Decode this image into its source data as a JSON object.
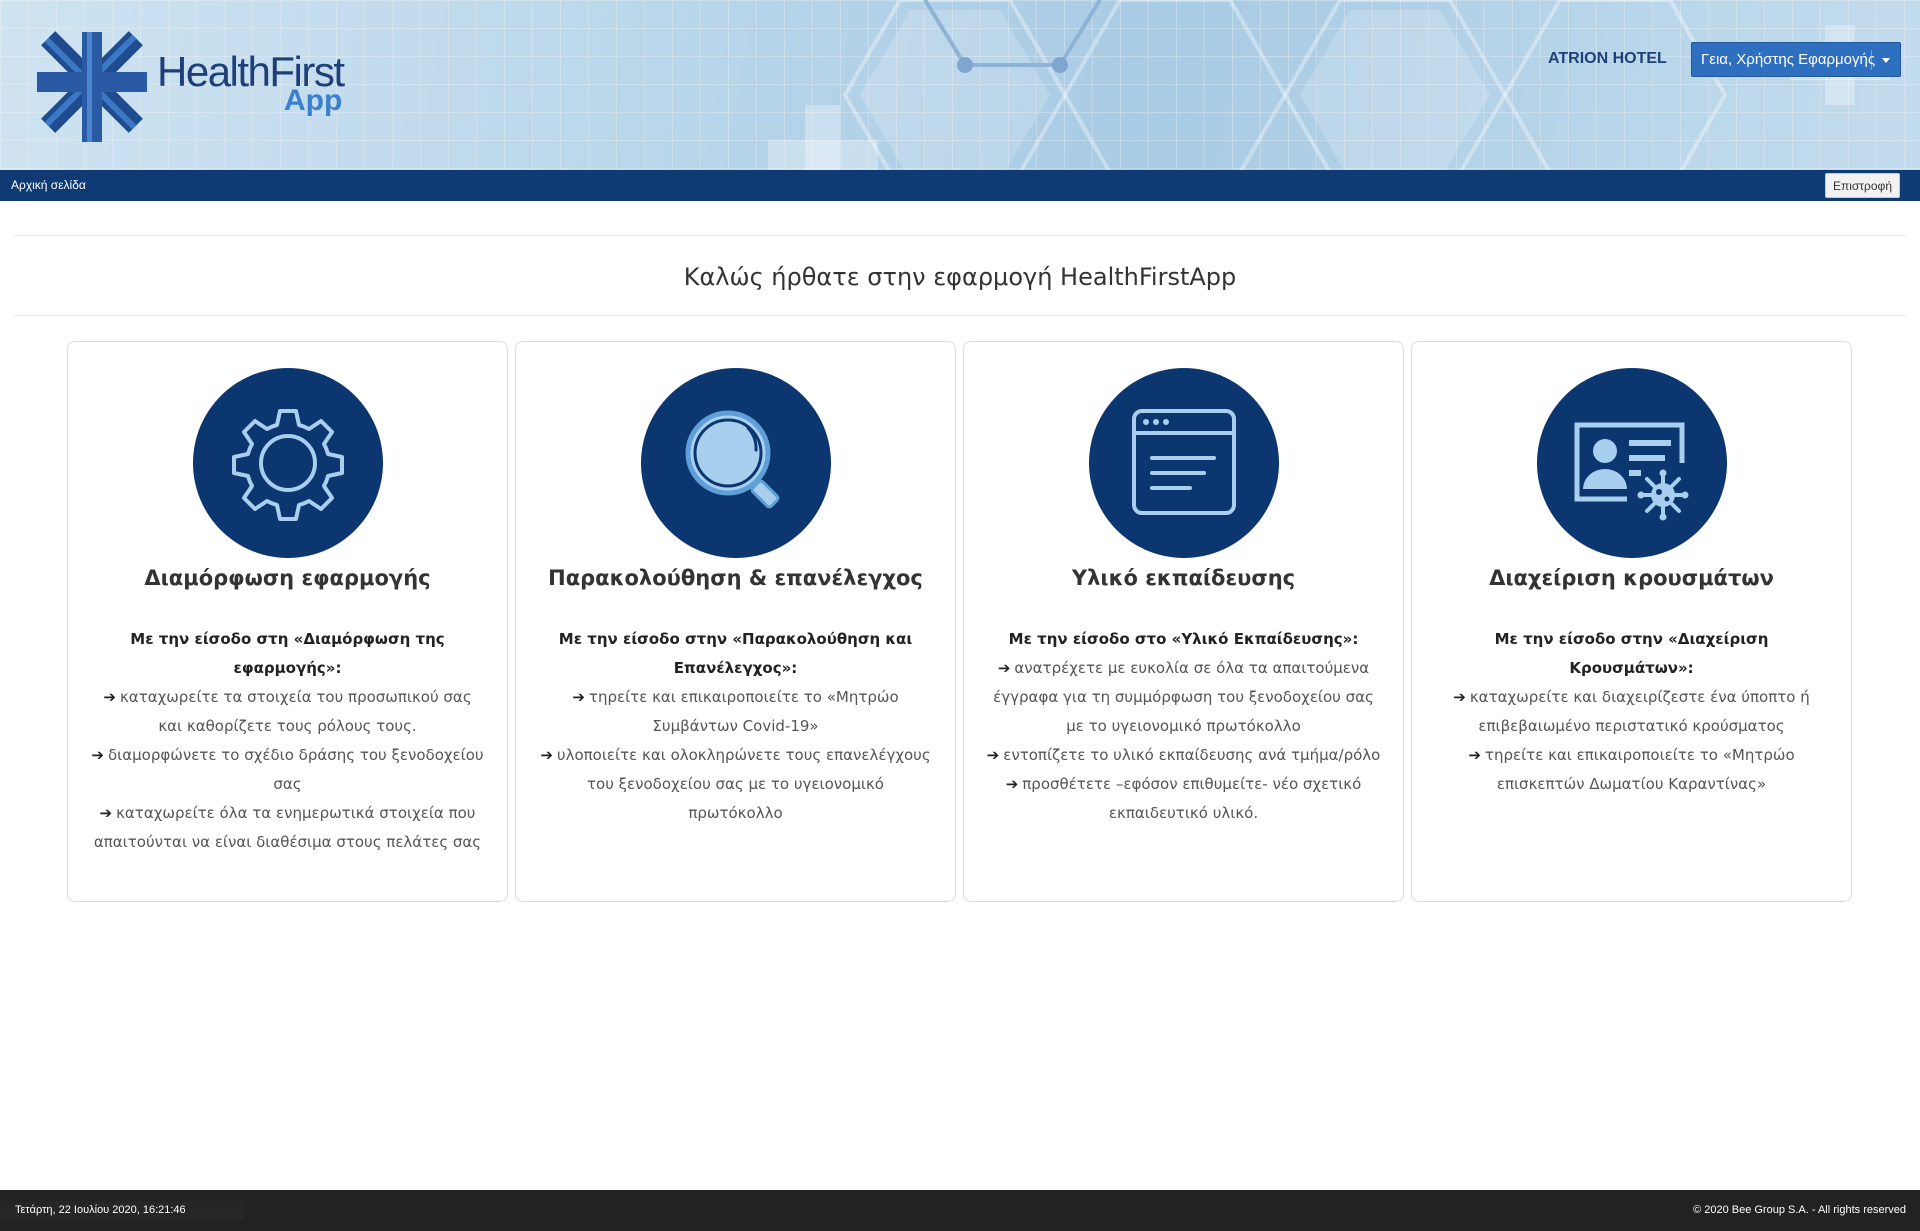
{
  "header": {
    "logo_main": "HealthFirst",
    "logo_app": "App",
    "hotel_name": "ATRION HOTEL",
    "user_greeting": "Γεια, Χρήστης Εφαρμογής"
  },
  "nav": {
    "home_label": "Αρχική σελίδα",
    "back_label": "Επιστροφή"
  },
  "main": {
    "welcome_title": "Καλώς ήρθατε στην εφαρμογή HealthFirstApp",
    "cards": [
      {
        "icon": "gear-icon",
        "title": "Διαμόρφωση εφαρμογής",
        "lead": "Με την είσοδο στη «Διαμόρφωση της εφαρμογής»:",
        "items": [
          "καταχωρείτε τα στοιχεία του προσωπικού σας και καθορίζετε τους ρόλους τους.",
          "διαμορφώνετε το σχέδιο δράσης του ξενοδοχείου σας",
          "καταχωρείτε όλα τα ενημερωτικά στοιχεία που απαιτούνται να είναι διαθέσιμα στους πελάτες σας"
        ]
      },
      {
        "icon": "magnifier-icon",
        "title": "Παρακολούθηση & επανέλεγχος",
        "lead": "Με την είσοδο στην «Παρακολούθηση και Επανέλεγχος»:",
        "items": [
          "τηρείτε και επικαιροποιείτε το «Μητρώο Συμβάντων Covid-19»",
          "υλοποιείτε και ολοκληρώνετε τους επανελέγχους του ξενοδοχείου σας με το υγειονομικό πρωτόκολλο"
        ]
      },
      {
        "icon": "document-window-icon",
        "title": "Υλικό εκπαίδευσης",
        "lead": "Με την είσοδο στο «Υλικό Εκπαίδευσης»:",
        "items": [
          "ανατρέχετε με ευκολία σε όλα τα απαιτούμενα έγγραφα για τη συμμόρφωση του ξενοδοχείου σας με το υγειονομικό πρωτόκολλο",
          "εντοπίζετε το υλικό εκπαίδευσης ανά τμήμα/ρόλο",
          "προσθέτετε –εφόσον επιθυμείτε- νέο σχετικό εκπαιδευτικό υλικό."
        ]
      },
      {
        "icon": "id-card-virus-icon",
        "title": "Διαχείριση κρουσμάτων",
        "lead": "Με την είσοδο στην «Διαχείριση Κρουσμάτων»:",
        "items": [
          "καταχωρείτε και διαχειρίζεστε ένα ύποπτο ή επιβεβαιωμένο περιστατικό κρούσματος",
          "τηρείτε και επικαιροποιείτε το «Μητρώο επισκεπτών Δωματίου Καραντίνας»"
        ]
      }
    ]
  },
  "footer": {
    "datetime": "Τετάρτη, 22 Ιουλίου 2020, 16:21:46",
    "copyright": "© 2020 Bee Group S.A. - All rights reserved"
  },
  "colors": {
    "header_bg": "#b9d6ea",
    "navbar_bg": "#0f3a74",
    "icon_circle": "#0b3670",
    "icon_line": "#a9cfef",
    "dropdown_bg": "#2f6fc0",
    "footer_bg": "#222222"
  }
}
